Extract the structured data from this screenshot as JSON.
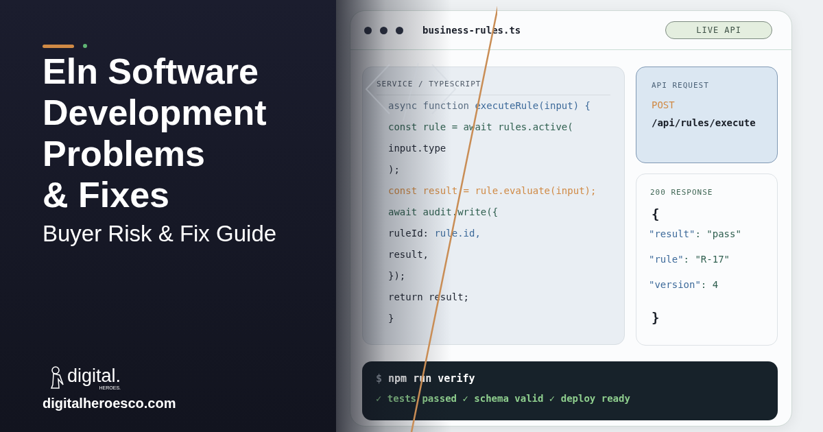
{
  "hero": {
    "title_lines": [
      "Eln Software",
      "Development",
      "Problems",
      "& Fixes"
    ],
    "subtitle": "Buyer Risk & Fix Guide"
  },
  "brand": {
    "logo_word": "digital.",
    "logo_sub": "HEROES.",
    "website": "digitalheroesco.com"
  },
  "editor": {
    "filename": "business-rules.ts",
    "badge": "LIVE API",
    "code": {
      "label": "SERVICE / TYPESCRIPT",
      "lines": [
        [
          {
            "text": "async function ",
            "kind": "keyword"
          },
          {
            "text": "executeRule(input) {",
            "kind": "fn"
          }
        ],
        [
          {
            "text": "const rule = await rules.active(",
            "kind": "call"
          }
        ],
        [
          {
            "text": "input.type",
            "kind": "plain"
          }
        ],
        [
          {
            "text": ");",
            "kind": "plain"
          }
        ],
        [
          {
            "text": "const result = rule.evaluate(input);",
            "kind": "accent"
          }
        ],
        [
          {
            "text": "await audit.write({",
            "kind": "call"
          }
        ],
        [
          {
            "text": "ruleId: ",
            "kind": "plain"
          },
          {
            "text": "rule.id,",
            "kind": "fn"
          }
        ],
        [
          {
            "text": "result,",
            "kind": "plain"
          }
        ],
        [
          {
            "text": "});",
            "kind": "plain"
          }
        ],
        [
          {
            "text": "return result;",
            "kind": "plain"
          }
        ],
        [
          {
            "text": "}",
            "kind": "plain"
          }
        ]
      ]
    },
    "request": {
      "label": "API REQUEST",
      "method": "POST",
      "path": "/api/rules/execute"
    },
    "response": {
      "label": "200 RESPONSE",
      "open": "{",
      "close": "}",
      "fields": [
        {
          "key": "\"result\"",
          "sep": ": ",
          "value": "\"pass\""
        },
        {
          "key": "\"rule\"",
          "sep": ": ",
          "value": "\"R-17\""
        },
        {
          "key": "\"version\"",
          "sep": ": ",
          "value": "4"
        }
      ]
    },
    "terminal": {
      "prompt": "$",
      "command": "npm run verify",
      "output": "✓ tests passed ✓ schema valid ✓ deploy ready"
    }
  }
}
